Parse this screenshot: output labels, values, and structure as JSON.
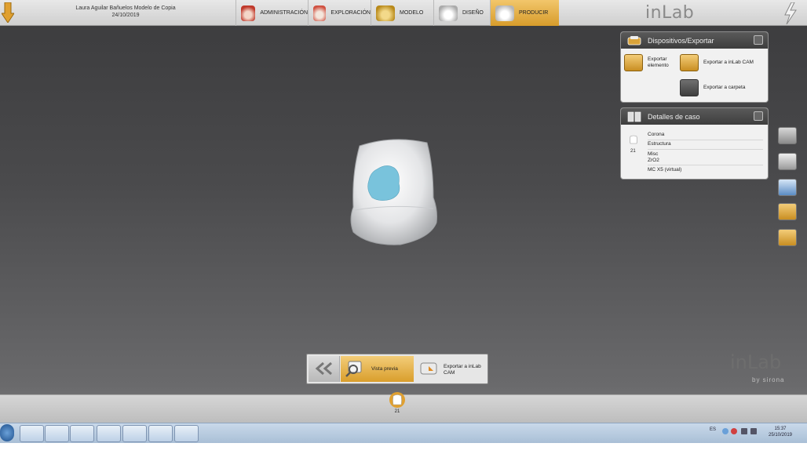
{
  "header": {
    "case_name": "Laura Aguilar Bañuelos Modelo de Copia",
    "case_date": "24/10/2019",
    "steps": [
      {
        "label": "ADMINISTRACIÓN",
        "icon": "administration-icon"
      },
      {
        "label": "EXPLORACIÓN",
        "icon": "scan-icon"
      },
      {
        "label": "MODELO",
        "icon": "model-icon"
      },
      {
        "label": "DISEÑO",
        "icon": "design-icon"
      },
      {
        "label": "PRODUCIR",
        "icon": "produce-icon",
        "active": true
      }
    ],
    "brand": "inLab"
  },
  "panels": {
    "devices": {
      "title": "Dispositivos/Exportar",
      "buttons": [
        {
          "label_line1": "Exportar",
          "label_line2": "elemento"
        },
        {
          "label": "Exportar a inLab CAM"
        },
        {
          "label": "Exportar a carpeta"
        }
      ]
    },
    "case_details": {
      "title": "Detalles de caso",
      "tooth_number": "21",
      "lines": [
        "Corona",
        "Estructura",
        "Misc",
        "ZrO2",
        "MC X5 (virtual)"
      ]
    }
  },
  "toolbar": {
    "preview_label": "Vista previa",
    "export_label_line1": "Exportar a inLab",
    "export_label_line2": "CAM"
  },
  "watermark": {
    "brand": "inLab",
    "sub": "by sirona"
  },
  "tooth_strip": {
    "tooth_number": "21"
  },
  "taskbar": {
    "language": "ES",
    "time": "15:37",
    "date": "25/10/2019"
  },
  "colors": {
    "accent": "#d99e2c",
    "viewport": "#4a4a4c",
    "crown": "#e9eaec",
    "crown_inner": "#79c3dc"
  }
}
